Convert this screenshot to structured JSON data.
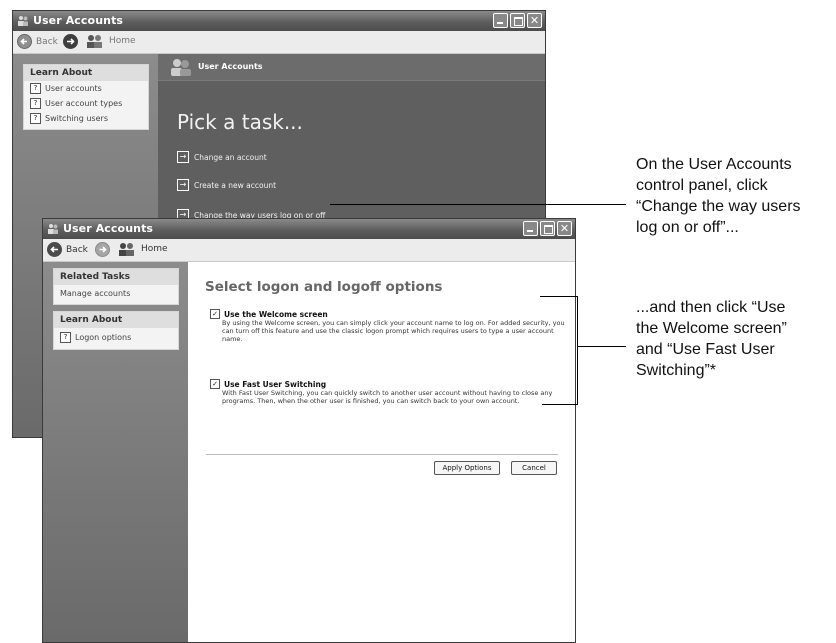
{
  "back_window": {
    "title": "User Accounts",
    "toolbar": {
      "back": "Back",
      "home": "Home"
    },
    "learn_about": {
      "header": "Learn About",
      "items": [
        "User accounts",
        "User account types",
        "Switching users"
      ]
    },
    "strip_title": "User Accounts",
    "heading": "Pick a task...",
    "tasks": [
      "Change an account",
      "Create a new account",
      "Change the way users log on or off"
    ]
  },
  "front_window": {
    "title": "User Accounts",
    "toolbar": {
      "back": "Back",
      "home": "Home"
    },
    "related_tasks": {
      "header": "Related Tasks",
      "items": [
        "Manage accounts"
      ]
    },
    "learn_about": {
      "header": "Learn About",
      "items": [
        "Logon options"
      ]
    },
    "heading": "Select logon and logoff options",
    "options": [
      {
        "label": "Use the Welcome screen",
        "checked": true,
        "description": "By using the Welcome screen, you can simply click your account name to log on. For added security, you can turn off this feature and use the classic logon prompt which requires users to type a user account name."
      },
      {
        "label": "Use Fast User Switching",
        "checked": true,
        "description": "With Fast User Switching, you can quickly switch to another user account without having to close any programs. Then, when the other user is finished, you can switch back to your own account."
      }
    ],
    "buttons": {
      "apply": "Apply Options",
      "cancel": "Cancel"
    }
  },
  "annotations": [
    {
      "lines": [
        "On the User Accounts",
        "control panel, click",
        "“Change the way users",
        "log on or off”..."
      ]
    },
    {
      "lines": [
        "...and then click “Use",
        "the Welcome screen”",
        "and “Use Fast User",
        "Switching”*"
      ]
    }
  ],
  "icons": {
    "check": "✓",
    "question": "?",
    "arrow": "→"
  }
}
